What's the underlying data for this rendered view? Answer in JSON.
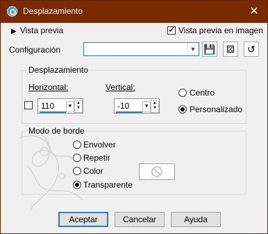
{
  "window": {
    "title": "Desplazamiento"
  },
  "preview": {
    "toggle_label": "Vista previa",
    "checkbox_label": "Vista previa en imagen",
    "checked": true
  },
  "config": {
    "label": "Configuración",
    "combo_value": ""
  },
  "displacement": {
    "group_title": "Desplazamiento",
    "horizontal_label": "Horizontal:",
    "vertical_label": "Vertical:",
    "horizontal_value": "110",
    "vertical_value": "-10",
    "centro_label": "Centro",
    "personalizado_label": "Personalizado",
    "selected": "Personalizado"
  },
  "border_mode": {
    "group_title": "Modo de borde",
    "options": [
      "Envolver",
      "Repetir",
      "Color",
      "Transparente"
    ],
    "selected": "Transparente"
  },
  "buttons": {
    "accept": "Aceptar",
    "cancel": "Cancelar",
    "help": "Ayuda"
  },
  "icons": [
    "app-icon",
    "close-icon",
    "save-icon",
    "dice-icon",
    "reset-icon",
    "no-color-icon"
  ],
  "colors": {
    "titlebar": "#7a2a00",
    "accent": "#2f7ebc"
  }
}
